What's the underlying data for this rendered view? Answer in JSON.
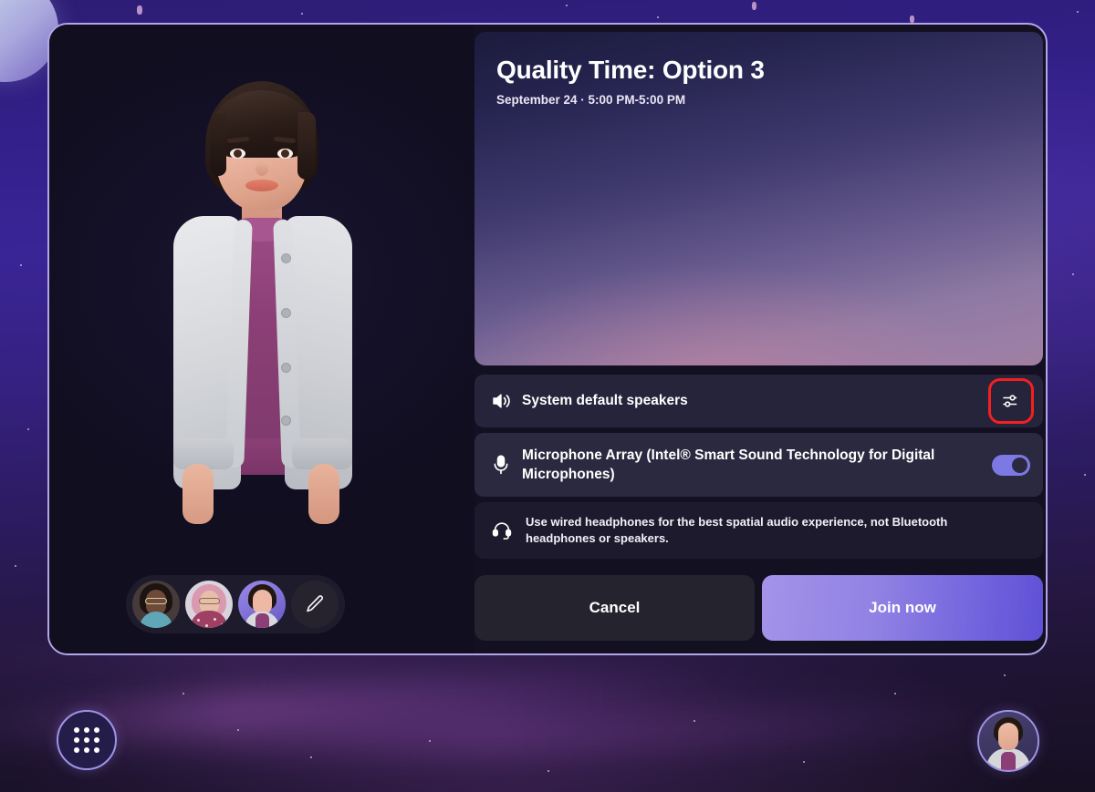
{
  "meeting": {
    "title": "Quality Time: Option 3",
    "datetime": "September 24 · 5:00 PM-5:00 PM"
  },
  "devices": {
    "speaker": {
      "label": "System default speakers",
      "icon": "speaker-icon",
      "settings_icon": "audio-settings-sliders-icon",
      "settings_highlighted": true
    },
    "microphone": {
      "label": "Microphone Array (Intel® Smart Sound Technology for Digital Microphones)",
      "icon": "microphone-icon",
      "toggle_on": true
    },
    "tip": {
      "text": "Use wired headphones for the best spatial audio experience, not Bluetooth headphones or speakers.",
      "icon": "headset-icon"
    }
  },
  "actions": {
    "cancel_label": "Cancel",
    "join_label": "Join now"
  },
  "avatar_picker": {
    "options": [
      {
        "name": "avatar-option-1",
        "selected": false
      },
      {
        "name": "avatar-option-2",
        "selected": false
      },
      {
        "name": "avatar-option-3",
        "selected": true
      }
    ],
    "edit_icon": "pencil-icon"
  },
  "taskbar": {
    "app_launcher_icon": "grid-apps-icon",
    "user_avatar_icon": "user-avatar-icon"
  },
  "colors": {
    "accent_purple": "#7d79e4",
    "join_gradient_start": "#a493e8",
    "join_gradient_end": "#5f51d6",
    "dialog_border": "#b3a6e8",
    "highlight_red": "#f42020",
    "panel_dark": "#131022",
    "row_bg": "#26243a"
  }
}
